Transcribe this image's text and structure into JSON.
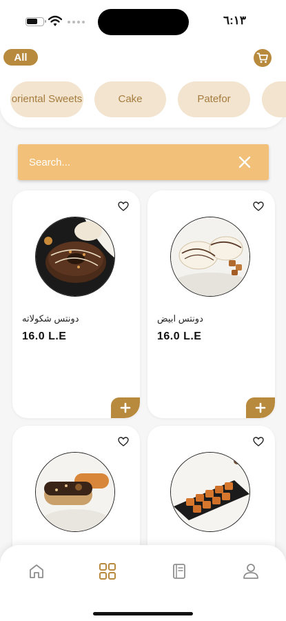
{
  "status_bar": {
    "time": "٦:١٣"
  },
  "header": {
    "filter_chip": "All",
    "cart_icon": "cart-icon",
    "categories": [
      {
        "label": "oriental Sweets"
      },
      {
        "label": "Cake"
      },
      {
        "label": "Patefor"
      },
      {
        "label": ""
      }
    ]
  },
  "search": {
    "placeholder": "Search...",
    "clear_icon": "close-icon"
  },
  "products": [
    {
      "name": "دونتس شكولاته",
      "price": "16.0 L.E"
    },
    {
      "name": "دونتس ابيض",
      "price": "16.0 L.E"
    },
    {
      "name": "",
      "price": ""
    },
    {
      "name": "",
      "price": ""
    }
  ],
  "nav": {
    "items": [
      {
        "icon": "home-icon"
      },
      {
        "icon": "grid-icon",
        "active": true
      },
      {
        "icon": "menu-book-icon"
      },
      {
        "icon": "profile-icon"
      }
    ]
  },
  "colors": {
    "accent": "#b88a3e",
    "chip_bg": "#f2e4cf",
    "search_bg": "#f2c078"
  }
}
